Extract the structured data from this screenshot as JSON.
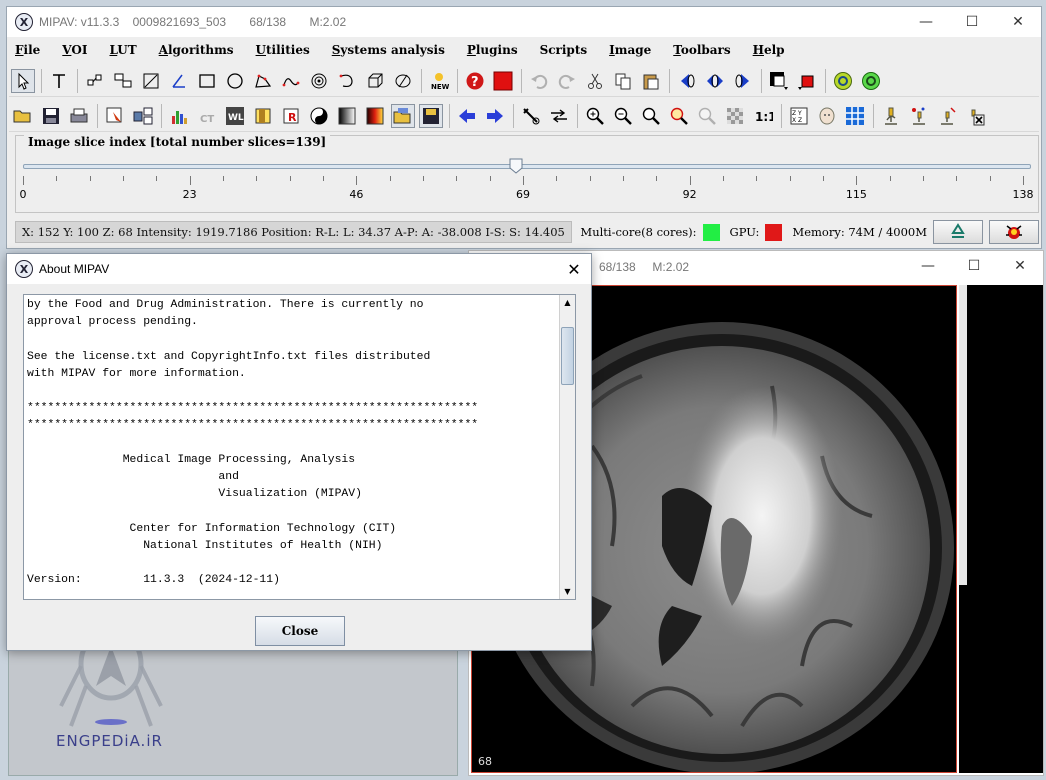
{
  "main_window": {
    "app_name": "MIPAV:",
    "version": "v11.3.3",
    "image_id": "0009821693_503",
    "slice_position": "68/138",
    "memory_label": "M:2.02"
  },
  "menu": [
    "File",
    "VOI",
    "LUT",
    "Algorithms",
    "Utilities",
    "Systems analysis",
    "Plugins",
    "Scripts",
    "Image",
    "Toolbars",
    "Help"
  ],
  "menu_mnemonics": [
    "F",
    "V",
    "L",
    "A",
    "U",
    "S",
    "P",
    "",
    "I",
    "T",
    "H"
  ],
  "slider": {
    "title": "Image slice index  [total number slices=139]",
    "value": 68,
    "min": 0,
    "max": 138,
    "tick_labels": [
      "0",
      "23",
      "46",
      "69",
      "92",
      "115",
      "138"
    ]
  },
  "status": {
    "info": "X: 152 Y: 100 Z: 68  Intensity:  1919.7186 Position: R-L: L: 34.37 A-P: A: -38.008 I-S: S: 14.405",
    "multicore_label": "Multi-core(8 cores):",
    "gpu_label": "GPU:",
    "memory_label": "Memory: 74M / 4000M",
    "multicore_color": "#22ee44",
    "gpu_color": "#e01818"
  },
  "image_window": {
    "slice_position": "68/138",
    "memory_label": "M:2.02",
    "slice_number": "68"
  },
  "about_dialog": {
    "title": "About MIPAV",
    "text": "by the Food and Drug Administration. There is currently no\napproval process pending.\n\nSee the license.txt and CopyrightInfo.txt files distributed\nwith MIPAV for more information.\n\n******************************************************************\n******************************************************************\n\n              Medical Image Processing, Analysis\n                            and\n                            Visualization (MIPAV)\n\n               Center for Information Technology (CIT)\n                 National Institutes of Health (NIH)\n\nVersion:         11.3.3  (2024-12-11)",
    "close_label": "Close"
  },
  "watermark": {
    "text": "ENGPEDiA.iR"
  }
}
